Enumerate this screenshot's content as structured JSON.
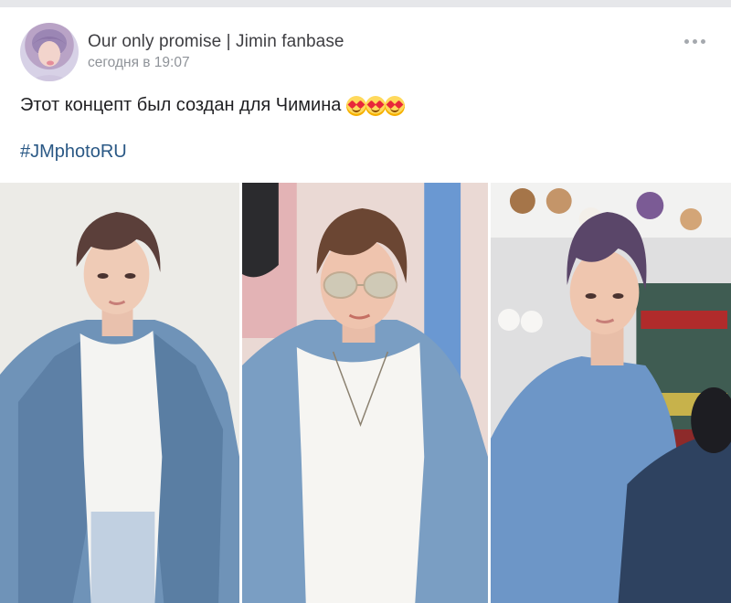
{
  "post": {
    "author": "Our only promise | Jimin fanbase",
    "date": "сегодня в 19:07",
    "text": "Этот концепт был создан для Чимина",
    "emojis": [
      "heart-eyes-emoji",
      "heart-eyes-emoji",
      "heart-eyes-emoji"
    ],
    "hashtag": "#JMphotoRU",
    "menu_icon": "more-dots-icon"
  },
  "colors": {
    "page_bg": "#edeef0",
    "card_bg": "#ffffff",
    "link": "#2a5885",
    "meta_text": "#8f9399"
  }
}
